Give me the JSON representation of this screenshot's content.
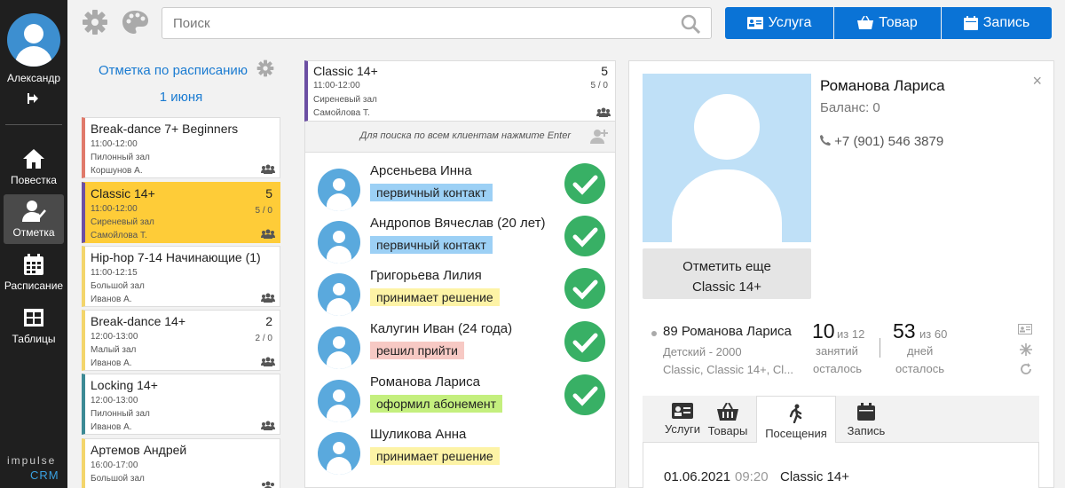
{
  "user": {
    "name": "Александр"
  },
  "nav": {
    "items": [
      {
        "label": "Повестка"
      },
      {
        "label": "Отметка"
      },
      {
        "label": "Расписание"
      },
      {
        "label": "Таблицы"
      }
    ],
    "logo_top": "impulse",
    "logo_bottom": "CRM"
  },
  "search": {
    "placeholder": "Поиск"
  },
  "toolbar": {
    "service_label": "Услуга",
    "product_label": "Товар",
    "booking_label": "Запись"
  },
  "schedule": {
    "title": "Отметка по расписанию",
    "date": "1 июня",
    "cards": [
      {
        "title": "Break-dance 7+ Beginners",
        "time": "11:00-12:00",
        "room": "Пилонный зал",
        "teacher": "Коршунов А.",
        "count": "",
        "ratio": "",
        "color": "#e07a6b"
      },
      {
        "title": "Classic 14+",
        "time": "11:00-12:00",
        "room": "Сиреневый зал",
        "teacher": "Самойлова Т.",
        "count": "5",
        "ratio": "5 / 0",
        "color": "#6c4fa3"
      },
      {
        "title": "Hip-hop 7-14 Начинающие (1)",
        "time": "11:00-12:15",
        "room": "Большой зал",
        "teacher": "Иванов А.",
        "count": "",
        "ratio": "",
        "color": "#f3d56b"
      },
      {
        "title": "Break-dance 14+",
        "time": "12:00-13:00",
        "room": "Малый зал",
        "teacher": "Иванов А.",
        "count": "2",
        "ratio": "2 / 0",
        "color": "#f3d56b"
      },
      {
        "title": "Locking 14+",
        "time": "12:00-13:00",
        "room": "Пилонный зал",
        "teacher": "Иванов А.",
        "count": "",
        "ratio": "",
        "color": "#3c8a95"
      },
      {
        "title": "Артемов Андрей",
        "time": "16:00-17:00",
        "room": "Большой зал",
        "teacher": "",
        "count": "",
        "ratio": "",
        "color": "#f3d56b"
      }
    ]
  },
  "lesson": {
    "title": "Classic 14+",
    "count": "5",
    "time": "11:00-12:00",
    "ratio": "5 / 0",
    "room": "Сиреневый зал",
    "teacher": "Самойлова Т."
  },
  "hint": "Для поиска по всем клиентам нажмите Enter",
  "clients": [
    {
      "name": "Арсеньева Инна",
      "status": "первичный контакт",
      "status_color": "#9cd0f5",
      "checked": true
    },
    {
      "name": "Андропов Вячеслав (20 лет)",
      "status": "первичный контакт",
      "status_color": "#9cd0f5",
      "checked": true
    },
    {
      "name": "Григорьева Лилия",
      "status": "принимает решение",
      "status_color": "#fdf3a6",
      "checked": true
    },
    {
      "name": "Калугин Иван (24 года)",
      "status": "решил прийти",
      "status_color": "#f7c9c4",
      "checked": true
    },
    {
      "name": "Романова Лариса",
      "status": "оформил абонемент",
      "status_color": "#c4ef7e",
      "checked": true
    },
    {
      "name": "Шуликова Анна",
      "status": "принимает решение",
      "status_color": "#fdf3a6",
      "checked": false
    }
  ],
  "profile": {
    "name": "Романова Лариса",
    "balance": "Баланс: 0",
    "phone": "+7 (901) 546 3879",
    "mark_again_line1": "Отметить еще",
    "mark_again_line2": "Classic 14+",
    "close": "×",
    "subscription": {
      "name": "89 Романова Лариса",
      "type": "Детский - 2000",
      "classes": "Classic, Classic 14+, Cl...",
      "lessons_left": "10",
      "lessons_of": "из 12",
      "lessons_label1": "занятий",
      "lessons_label2": "осталось",
      "days_left": "53",
      "days_of": "из 60",
      "days_label1": "дней",
      "days_label2": "осталось"
    },
    "tabs": [
      {
        "label": "Услуги"
      },
      {
        "label": "Товары"
      },
      {
        "label": "Посещения"
      },
      {
        "label": "Запись"
      }
    ],
    "visit": {
      "date": "01.06.2021",
      "time": "09:20",
      "class": "Classic 14+"
    }
  },
  "colors": {
    "accent": "#0a73d6",
    "link": "#1a7bd1",
    "selected_card": "#fecc38",
    "check": "#38b065",
    "nav_bg": "#1f1f1f"
  }
}
